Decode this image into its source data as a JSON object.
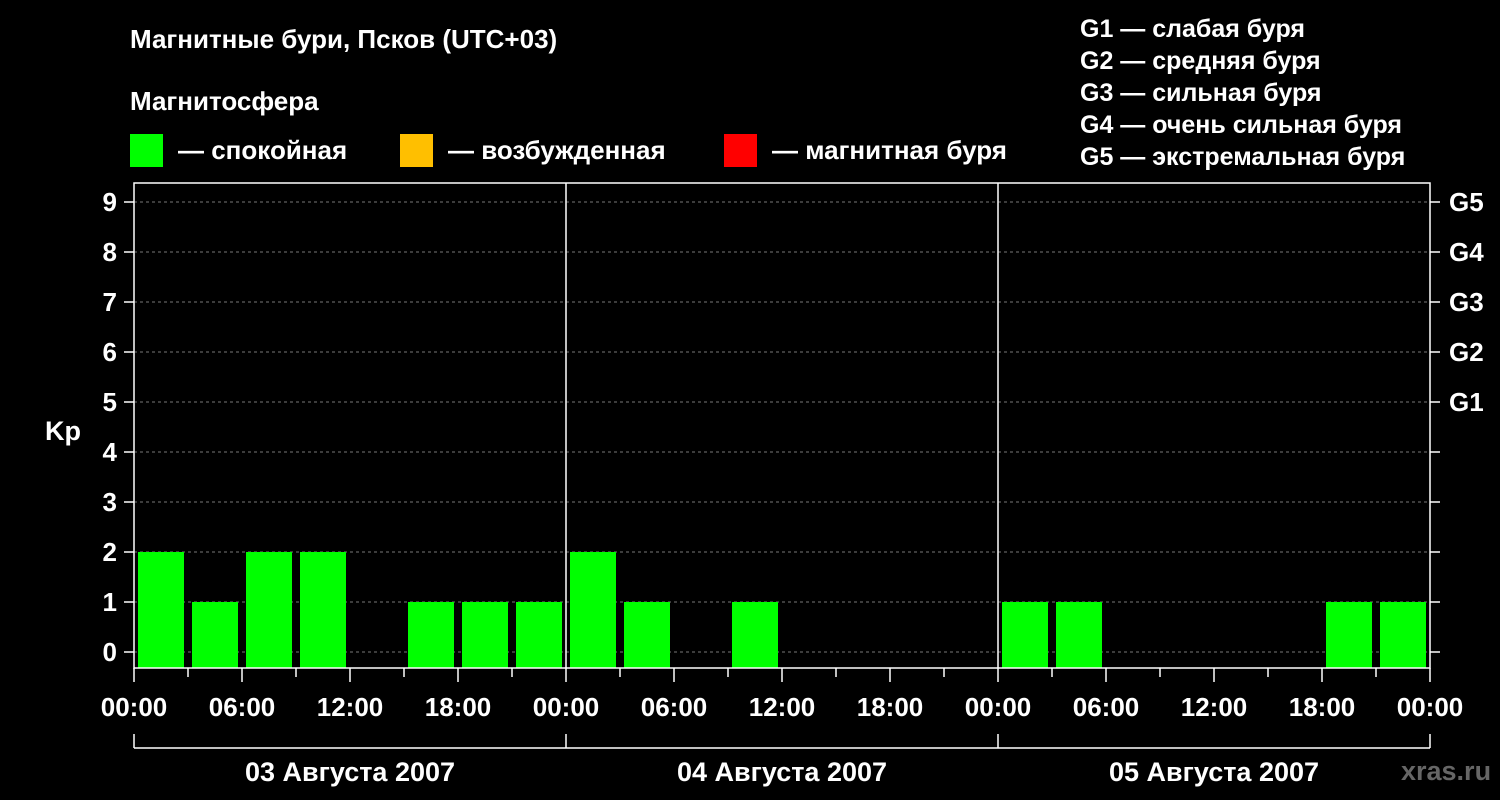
{
  "header": {
    "title": "Магнитные бури, Псков (UTC+03)",
    "subtitle": "Магнитосфера"
  },
  "legend": [
    {
      "color": "#00ff00",
      "label": "— спокойная"
    },
    {
      "color": "#ffbf00",
      "label": "— возбужденная"
    },
    {
      "color": "#ff0000",
      "label": "— магнитная буря"
    }
  ],
  "g_legend": [
    "G1 — слабая буря",
    "G2 — средняя буря",
    "G3 — сильная буря",
    "G4 — очень сильная буря",
    "G5 — экстремальная буря"
  ],
  "watermark": "xras.ru",
  "chart_data": {
    "type": "bar",
    "ylabel": "Kp",
    "ylim": [
      0,
      9
    ],
    "y_ticks": [
      "0",
      "1",
      "2",
      "3",
      "4",
      "5",
      "6",
      "7",
      "8",
      "9"
    ],
    "right_ticks": [
      {
        "value": 5,
        "label": "G1"
      },
      {
        "value": 6,
        "label": "G2"
      },
      {
        "value": 7,
        "label": "G3"
      },
      {
        "value": 8,
        "label": "G4"
      },
      {
        "value": 9,
        "label": "G5"
      }
    ],
    "x_tick_labels": [
      "00:00",
      "06:00",
      "12:00",
      "18:00",
      "00:00",
      "06:00",
      "12:00",
      "18:00",
      "00:00",
      "06:00",
      "12:00",
      "18:00",
      "00:00"
    ],
    "days": [
      "03 Августа 2007",
      "04 Августа 2007",
      "05 Августа 2007"
    ],
    "bar_color": "#00ff00",
    "values": [
      2,
      1,
      2,
      2,
      0,
      1,
      1,
      1,
      2,
      1,
      0,
      1,
      0,
      0,
      0,
      0,
      1,
      1,
      0,
      0,
      0,
      0,
      1,
      1
    ]
  }
}
